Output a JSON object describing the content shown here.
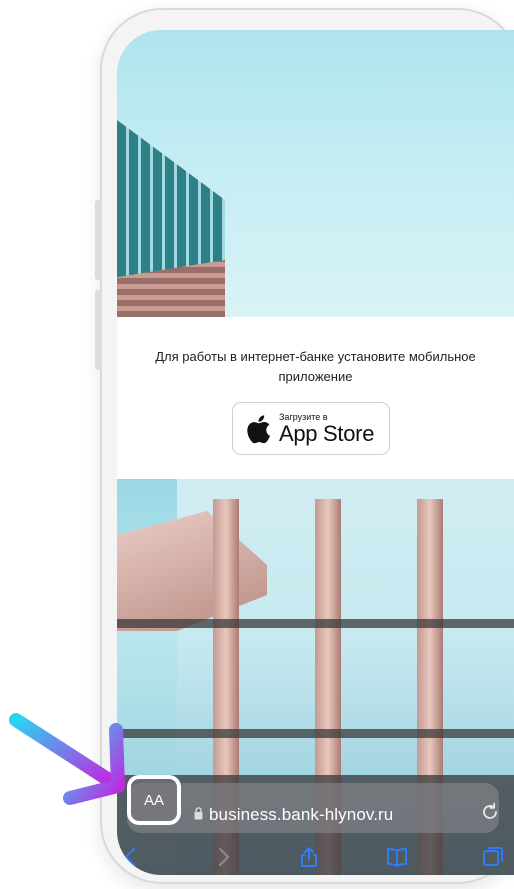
{
  "banner": {
    "message": "Для работы в интернет-банке установите мобильное приложение"
  },
  "app_store_badge": {
    "small_label": "Загрузите в",
    "big_label": "App Store"
  },
  "safari": {
    "text_size_label": "AA",
    "url": "business.bank-hlynov.ru"
  },
  "colors": {
    "arrow_start": "#2bd3f0",
    "arrow_end": "#c424e0",
    "toolbar_icon": "#2f7cf6"
  },
  "icons": [
    "apple-logo-icon",
    "lock-icon",
    "reload-icon",
    "back-icon",
    "forward-icon",
    "share-icon",
    "bookmarks-icon",
    "tabs-icon"
  ]
}
